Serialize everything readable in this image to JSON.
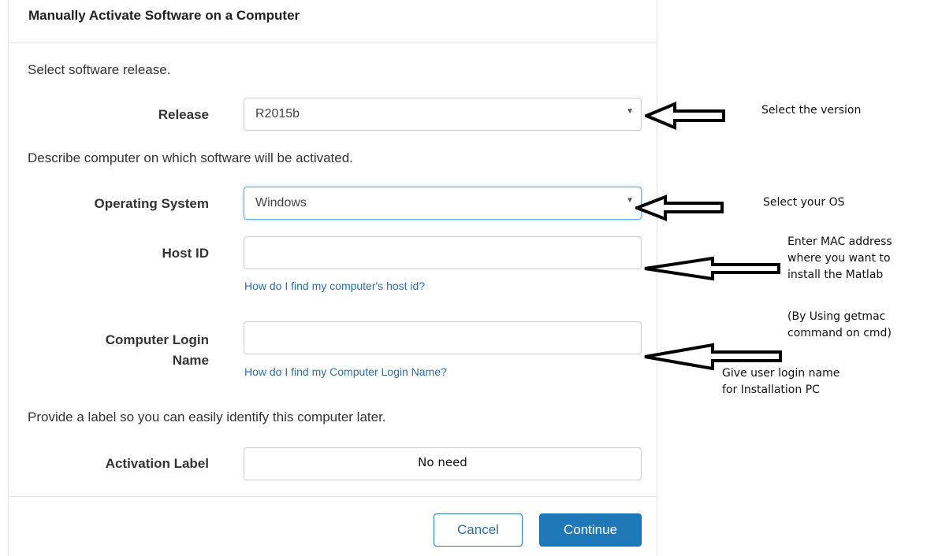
{
  "dialog": {
    "title": "Manually Activate Software on a Computer",
    "release_section": "Select software release.",
    "computer_section": "Describe computer on which software will be activated.",
    "label_section": "Provide a label so you can easily identify this computer later."
  },
  "fields": {
    "release": {
      "label": "Release",
      "value": "R2015b"
    },
    "os": {
      "label": "Operating System",
      "value": "Windows"
    },
    "host_id": {
      "label": "Host ID",
      "value": "",
      "help_link": "How do I find my computer's host id?"
    },
    "login": {
      "label_line1": "Computer Login",
      "label_line2": "Name",
      "value": "",
      "help_link": "How do I find my Computer Login Name?"
    },
    "activation_label": {
      "label": "Activation Label",
      "value": ""
    }
  },
  "buttons": {
    "cancel": "Cancel",
    "continue": "Continue"
  },
  "annotations": {
    "release": "Select the version",
    "os": "Select your OS",
    "host_line1": "Enter MAC address",
    "host_line2": "where you want to",
    "host_line3": "install the Matlab",
    "host_line4": "(By Using getmac",
    "host_line5": "command on cmd)",
    "login_line1": "Give user login name",
    "login_line2": "for  Installation PC",
    "activation_label": "No need"
  },
  "colors": {
    "link": "#2a6fa8",
    "primary_button": "#1f78b8",
    "focus_border": "#66afe9"
  }
}
